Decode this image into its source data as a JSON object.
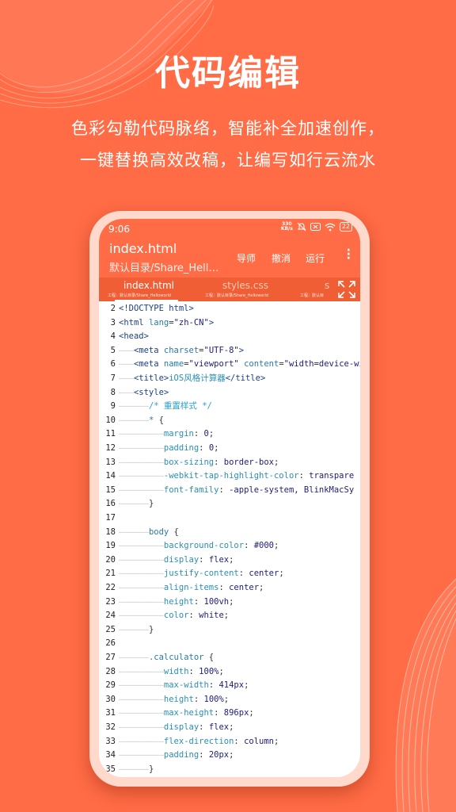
{
  "promo": {
    "title": "代码编辑",
    "subtitle_line1": "色彩勾勒代码脉络，智能补全加速创作，",
    "subtitle_line2": "一键替换高效改稿，让编写如行云流水"
  },
  "status_bar": {
    "time": "9:06",
    "net_speed_value": "330",
    "net_speed_unit": "KB/s",
    "battery": "22"
  },
  "app_bar": {
    "file_title": "index.html",
    "file_path": "默认目录/Share_Helloworld",
    "actions": [
      "导师",
      "撤消",
      "运行"
    ],
    "more_icon": "more-vert-icon"
  },
  "tabs": [
    {
      "name": "index.html",
      "sub": "工程：默认目录/Share_Helloworld",
      "active": true
    },
    {
      "name": "styles.css",
      "sub": "工程：默认目录/Share_Helloworld",
      "active": false
    },
    {
      "name": "s",
      "sub": "工程：默认目",
      "active": false
    }
  ],
  "colors": {
    "accent": "#ff6c46",
    "tab_bar": "#ef5e34",
    "tag": "#1c3f86",
    "attr": "#2a7aa8",
    "string": "#1d1d7a",
    "comment": "#2c9ec7"
  },
  "code": {
    "lines": [
      {
        "n": "2",
        "tokens": [
          [
            "tag",
            "<!DOCTYPE html>"
          ]
        ]
      },
      {
        "n": "3",
        "tokens": [
          [
            "tag",
            "<html "
          ],
          [
            "attr",
            "lang"
          ],
          [
            "punc",
            "="
          ],
          [
            "str",
            "\"zh-CN\""
          ],
          [
            "tag",
            ">"
          ]
        ]
      },
      {
        "n": "4",
        "tokens": [
          [
            "tag",
            "<head>"
          ]
        ]
      },
      {
        "n": "5",
        "tokens": [
          [
            "guide",
            "———"
          ],
          [
            "tag",
            "<meta "
          ],
          [
            "attr",
            "charset"
          ],
          [
            "punc",
            "="
          ],
          [
            "str",
            "\"UTF-8\""
          ],
          [
            "tag",
            ">"
          ]
        ]
      },
      {
        "n": "6",
        "tokens": [
          [
            "guide",
            "———"
          ],
          [
            "tag",
            "<meta "
          ],
          [
            "attr",
            "name"
          ],
          [
            "punc",
            "="
          ],
          [
            "str",
            "\"viewport\""
          ],
          [
            "attr",
            " content"
          ],
          [
            "punc",
            "="
          ],
          [
            "str",
            "\"width=device-wi"
          ]
        ]
      },
      {
        "n": "7",
        "tokens": [
          [
            "guide",
            "———"
          ],
          [
            "tag",
            "<title>"
          ],
          [
            "txt",
            "iOS风格计算器"
          ],
          [
            "tag",
            "</title>"
          ]
        ]
      },
      {
        "n": "8",
        "tokens": [
          [
            "guide",
            "———"
          ],
          [
            "tag",
            "<style>"
          ]
        ]
      },
      {
        "n": "9",
        "tokens": [
          [
            "guide",
            "——————"
          ],
          [
            "comment",
            "/* 重置样式 */"
          ]
        ]
      },
      {
        "n": "10",
        "tokens": [
          [
            "guide",
            "——————"
          ],
          [
            "sel",
            "* "
          ],
          [
            "punc",
            "{"
          ]
        ]
      },
      {
        "n": "11",
        "tokens": [
          [
            "guide",
            "—————————"
          ],
          [
            "prop",
            "margin"
          ],
          [
            "punc",
            ": "
          ],
          [
            "val",
            "0"
          ],
          [
            "punc",
            ";"
          ]
        ]
      },
      {
        "n": "12",
        "tokens": [
          [
            "guide",
            "—————————"
          ],
          [
            "prop",
            "padding"
          ],
          [
            "punc",
            ": "
          ],
          [
            "val",
            "0"
          ],
          [
            "punc",
            ";"
          ]
        ]
      },
      {
        "n": "13",
        "tokens": [
          [
            "guide",
            "—————————"
          ],
          [
            "prop",
            "box-sizing"
          ],
          [
            "punc",
            ": "
          ],
          [
            "val",
            "border-box"
          ],
          [
            "punc",
            ";"
          ]
        ]
      },
      {
        "n": "14",
        "tokens": [
          [
            "guide",
            "—————————"
          ],
          [
            "prop",
            "-webkit-tap-highlight-color"
          ],
          [
            "punc",
            ": "
          ],
          [
            "val",
            "transpare"
          ]
        ]
      },
      {
        "n": "15",
        "tokens": [
          [
            "guide",
            "—————————"
          ],
          [
            "prop",
            "font-family"
          ],
          [
            "punc",
            ": "
          ],
          [
            "val",
            "-apple-system, BlinkMacSy"
          ]
        ]
      },
      {
        "n": "16",
        "tokens": [
          [
            "guide",
            "——————"
          ],
          [
            "punc",
            "}"
          ]
        ]
      },
      {
        "n": "17",
        "tokens": []
      },
      {
        "n": "18",
        "tokens": [
          [
            "guide",
            "——————"
          ],
          [
            "sel",
            "body "
          ],
          [
            "punc",
            "{"
          ]
        ]
      },
      {
        "n": "19",
        "tokens": [
          [
            "guide",
            "—————————"
          ],
          [
            "prop",
            "background-color"
          ],
          [
            "punc",
            ": "
          ],
          [
            "val",
            "#000"
          ],
          [
            "punc",
            ";"
          ]
        ]
      },
      {
        "n": "20",
        "tokens": [
          [
            "guide",
            "—————————"
          ],
          [
            "prop",
            "display"
          ],
          [
            "punc",
            ": "
          ],
          [
            "val",
            "flex"
          ],
          [
            "punc",
            ";"
          ]
        ]
      },
      {
        "n": "21",
        "tokens": [
          [
            "guide",
            "—————————"
          ],
          [
            "prop",
            "justify-content"
          ],
          [
            "punc",
            ": "
          ],
          [
            "val",
            "center"
          ],
          [
            "punc",
            ";"
          ]
        ]
      },
      {
        "n": "22",
        "tokens": [
          [
            "guide",
            "—————————"
          ],
          [
            "prop",
            "align-items"
          ],
          [
            "punc",
            ": "
          ],
          [
            "val",
            "center"
          ],
          [
            "punc",
            ";"
          ]
        ]
      },
      {
        "n": "23",
        "tokens": [
          [
            "guide",
            "—————————"
          ],
          [
            "prop",
            "height"
          ],
          [
            "punc",
            ": "
          ],
          [
            "val",
            "100vh"
          ],
          [
            "punc",
            ";"
          ]
        ]
      },
      {
        "n": "24",
        "tokens": [
          [
            "guide",
            "—————————"
          ],
          [
            "prop",
            "color"
          ],
          [
            "punc",
            ": "
          ],
          [
            "val",
            "white"
          ],
          [
            "punc",
            ";"
          ]
        ]
      },
      {
        "n": "25",
        "tokens": [
          [
            "guide",
            "——————"
          ],
          [
            "punc",
            "}"
          ]
        ]
      },
      {
        "n": "26",
        "tokens": []
      },
      {
        "n": "27",
        "tokens": [
          [
            "guide",
            "——————"
          ],
          [
            "sel",
            ".calculator "
          ],
          [
            "punc",
            "{"
          ]
        ]
      },
      {
        "n": "28",
        "tokens": [
          [
            "guide",
            "—————————"
          ],
          [
            "prop",
            "width"
          ],
          [
            "punc",
            ": "
          ],
          [
            "val",
            "100%"
          ],
          [
            "punc",
            ";"
          ]
        ]
      },
      {
        "n": "29",
        "tokens": [
          [
            "guide",
            "—————————"
          ],
          [
            "prop",
            "max-width"
          ],
          [
            "punc",
            ": "
          ],
          [
            "val",
            "414px"
          ],
          [
            "punc",
            ";"
          ]
        ]
      },
      {
        "n": "30",
        "tokens": [
          [
            "guide",
            "—————————"
          ],
          [
            "prop",
            "height"
          ],
          [
            "punc",
            ": "
          ],
          [
            "val",
            "100%"
          ],
          [
            "punc",
            ";"
          ]
        ]
      },
      {
        "n": "31",
        "tokens": [
          [
            "guide",
            "—————————"
          ],
          [
            "prop",
            "max-height"
          ],
          [
            "punc",
            ": "
          ],
          [
            "val",
            "896px"
          ],
          [
            "punc",
            ";"
          ]
        ]
      },
      {
        "n": "32",
        "tokens": [
          [
            "guide",
            "—————————"
          ],
          [
            "prop",
            "display"
          ],
          [
            "punc",
            ": "
          ],
          [
            "val",
            "flex"
          ],
          [
            "punc",
            ";"
          ]
        ]
      },
      {
        "n": "33",
        "tokens": [
          [
            "guide",
            "—————————"
          ],
          [
            "prop",
            "flex-direction"
          ],
          [
            "punc",
            ": "
          ],
          [
            "val",
            "column"
          ],
          [
            "punc",
            ";"
          ]
        ]
      },
      {
        "n": "34",
        "tokens": [
          [
            "guide",
            "—————————"
          ],
          [
            "prop",
            "padding"
          ],
          [
            "punc",
            ": "
          ],
          [
            "val",
            "20px"
          ],
          [
            "punc",
            ";"
          ]
        ]
      },
      {
        "n": "35",
        "tokens": [
          [
            "guide",
            "——————"
          ],
          [
            "punc",
            "}"
          ]
        ]
      }
    ]
  }
}
